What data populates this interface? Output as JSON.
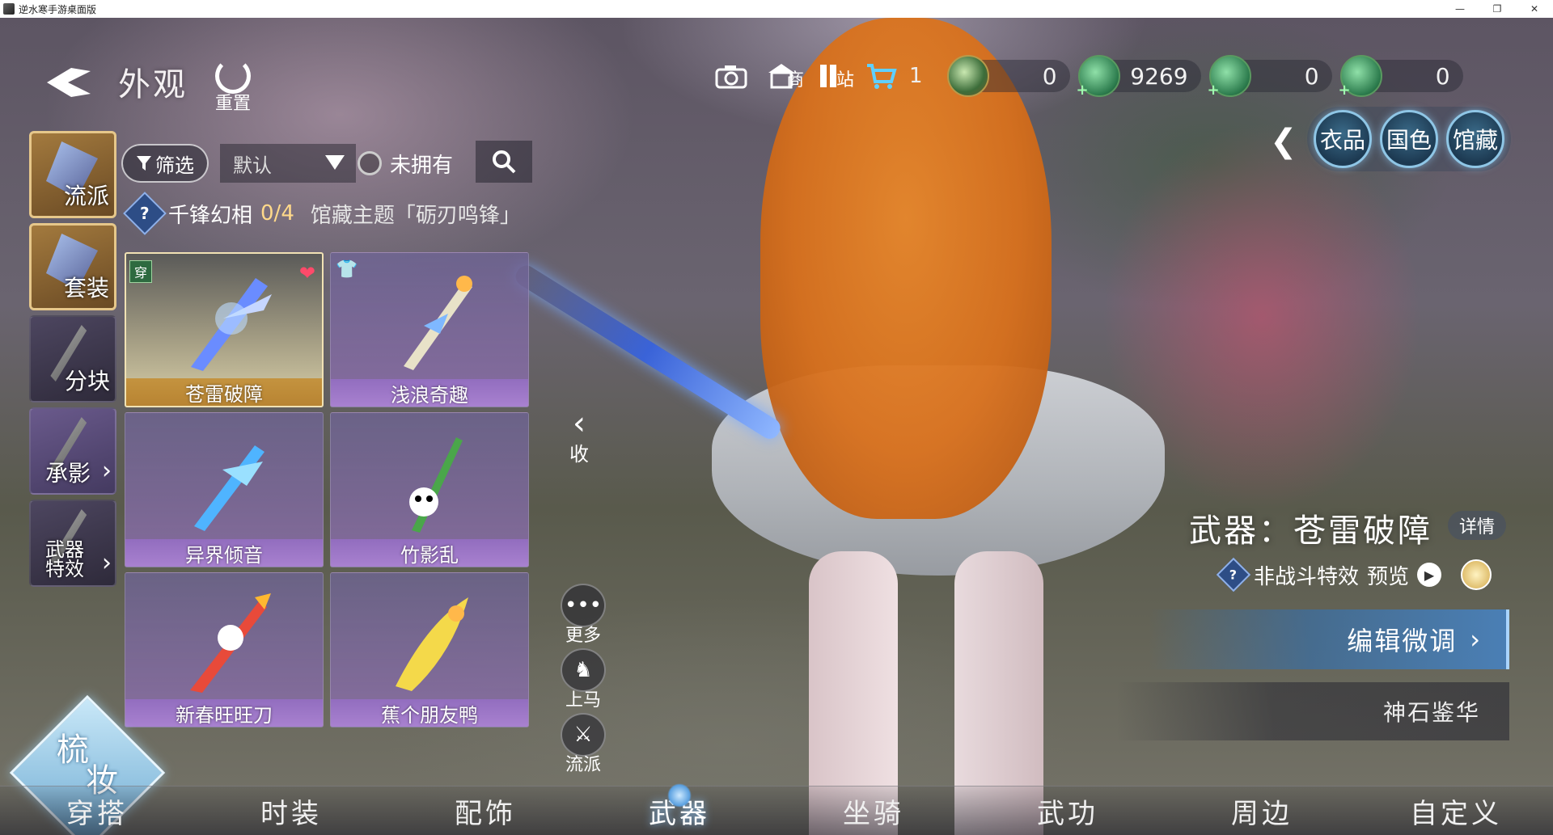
{
  "window": {
    "title": "逆水寒手游桌面版",
    "buttons": [
      "—",
      "❐",
      "✕"
    ]
  },
  "page": {
    "title": "外观",
    "reset_label": "重置"
  },
  "topbar": {
    "icons": [
      {
        "name": "camera-icon",
        "glyph": "📷",
        "sub": ""
      },
      {
        "name": "shop-icon",
        "glyph": "⛫",
        "sub": "商"
      },
      {
        "name": "station-icon",
        "glyph": "❚",
        "sub": "站"
      }
    ],
    "cart_count": "1",
    "currencies": [
      {
        "name": "jade-coin",
        "amount": "0",
        "style": "gold"
      },
      {
        "name": "green-gem-a",
        "amount": "9269",
        "style": "green"
      },
      {
        "name": "green-gem-b",
        "amount": "0",
        "style": "green"
      },
      {
        "name": "green-gem-c",
        "amount": "0",
        "style": "green"
      }
    ]
  },
  "categories": {
    "items": [
      "衣品",
      "国色",
      "馆藏"
    ]
  },
  "vtabs": {
    "items": [
      {
        "label": "流派",
        "state": "active"
      },
      {
        "label": "套装",
        "state": "active"
      },
      {
        "label": "分块",
        "state": "normal"
      },
      {
        "label": "承影",
        "state": "purple"
      },
      {
        "label": "武器特效",
        "state": "normal"
      }
    ],
    "weapon_fx_line1": "武器",
    "weapon_fx_line2": "特效"
  },
  "filter": {
    "filter_label": "筛选",
    "sort_value": "默认",
    "unowned_label": "未拥有"
  },
  "theme": {
    "name": "千锋幻相",
    "count": "0/4",
    "theme_label": "馆藏主题「砺刃鸣锋」"
  },
  "grid": {
    "items": [
      {
        "name": "苍雷破障",
        "selected": true,
        "badge": "穿",
        "fav": true
      },
      {
        "name": "浅浪奇趣",
        "selected": false,
        "badge": "",
        "fav": false
      },
      {
        "name": "异界倾音",
        "selected": false,
        "badge": "",
        "fav": false
      },
      {
        "name": "竹影乱",
        "selected": false,
        "badge": "",
        "fav": false
      },
      {
        "name": "新春旺旺刀",
        "selected": false,
        "badge": "",
        "fav": false
      },
      {
        "name": "蕉个朋友鸭",
        "selected": false,
        "badge": "",
        "fav": false
      }
    ]
  },
  "collapse_label": "收",
  "side_actions": {
    "more": "更多",
    "mount": "上马",
    "school": "流派"
  },
  "weapon": {
    "title": "武器：苍雷破障",
    "detail_label": "详情",
    "effect_label": "非战斗特效",
    "preview_label": "预览",
    "edit_label": "编辑微调",
    "shenshi_label": "神石鉴华"
  },
  "makeup": {
    "line1": "梳",
    "line2": "妆"
  },
  "bottom_nav": {
    "items": [
      "穿搭",
      "时装",
      "配饰",
      "武器",
      "坐骑",
      "武功",
      "周边",
      "自定义"
    ],
    "active_index": 3
  },
  "colors": {
    "accent": "#e6c78a",
    "selected_name_bg": "#c4933f",
    "item_purple": "#9a78c8",
    "button_blue": "#4a7fb5"
  }
}
